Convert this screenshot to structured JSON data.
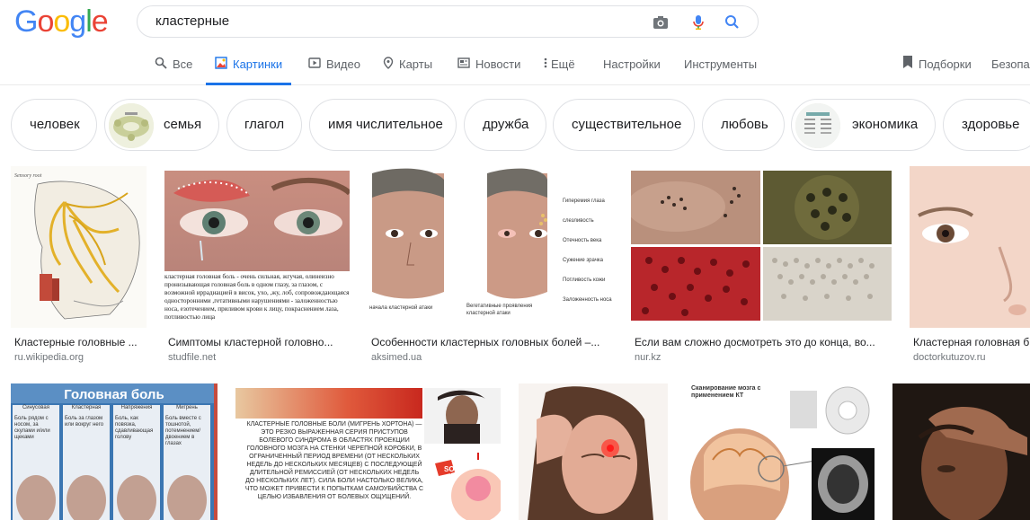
{
  "logo": [
    "G",
    "o",
    "o",
    "g",
    "l",
    "e"
  ],
  "search": {
    "query": "кластерные"
  },
  "icons": {
    "camera": "camera-icon",
    "mic": "mic-icon",
    "search": "search-icon"
  },
  "nav": {
    "all": "Все",
    "images": "Картинки",
    "video": "Видео",
    "maps": "Карты",
    "news": "Новости",
    "more": "Ещё",
    "settings": "Настройки",
    "tools": "Инструменты",
    "collections": "Подборки",
    "safe": "Безопа"
  },
  "chips": [
    "человек",
    "семья",
    "глагол",
    "имя числительное",
    "дружба",
    "существительное",
    "любовь",
    "экономика",
    "здоровье"
  ],
  "results": [
    {
      "caption": "Кластерные головные ...",
      "source": "ru.wikipedia.org"
    },
    {
      "caption": "Симптомы кластерной головно...",
      "source": "studfile.net"
    },
    {
      "caption": "Особенности кластерных головных болей –...",
      "source": "aksimed.ua"
    },
    {
      "caption": "Если вам сложно досмотреть это до конца, во...",
      "source": "nur.kz"
    },
    {
      "caption": "Кластерная головная б",
      "source": "doctorkutuzov.ru"
    }
  ],
  "image_text": {
    "r1_2_text": "кластерная головная боль - очень сильная, жгучая, олинеизно пронизывающая головная боль в одном глазу, за глазом, с возможной иррадиацией в висок, ухо, ,жу, лоб, сопровождающаяся односторонними ,гетативными нарушениями - заложенностью носа, езотечением, приливом крови к лицу, покраснением лаза, потливостью лица",
    "r1_3_labels": [
      "Гиперемия глаза слезливость",
      "Отечность века",
      "Сужение зрачка",
      "Потливость кожи",
      "Заложенность носа"
    ],
    "r1_3_left": "начала кластерной атаки",
    "r1_3_right": "Вегетативные проявления кластерной атаки",
    "r2_1_title": "Головная боль",
    "r2_1_cols": [
      "Синусовая",
      "Кластерная",
      "Напряжения",
      "Мигрень"
    ],
    "r2_1_desc": [
      "Боль рядом с носом, за скулами и/или щеками",
      "Боль за глазом или вокруг него",
      "Боль, как повязка, сдавливающая голову",
      "Боль вместе с тошнотой, потемнением/ двоением в глазах"
    ],
    "r2_2_text": "КЛАСТЕРНЫЕ ГОЛОВНЫЕ БОЛИ (МИГРЕНЬ ХОРТОНА) — ЭТО РЕЗКО ВЫРАЖЕННАЯ СЕРИЯ ПРИСТУПОВ БОЛЕВОГО СИНДРОМА В ОБЛАСТЯХ ПРОЕКЦИИ ГОЛОВНОГО МОЗГА НА СТЕНКИ ЧЕРЕПНОЙ КОРОБКИ, В ОГРАНИЧЕННЫЙ ПЕРИОД ВРЕМЕНИ (ОТ НЕСКОЛЬКИХ НЕДЕЛЬ ДО НЕСКОЛЬКИХ МЕСЯЦЕВ) С ПОСЛЕДУЮЩЕЙ ДЛИТЕЛЬНОЙ РЕМИССИЕЙ (ОТ НЕСКОЛЬКИХ НЕДЕЛЬ ДО НЕСКОЛЬКИХ ЛЕТ). СИЛА БОЛИ НАСТОЛЬКО ВЕЛИКА, ЧТО МОЖЕТ ПРИВЕСТИ К ПОПЫТКАМ САМОУБИЙСТВА С ЦЕЛЬЮ ИЗБАВЛЕНИЯ ОТ БОЛЕВЫХ ОЩУЩЕНИЙ.",
    "r2_2_sos": "SOS",
    "r2_4_text": "Сканирование мозга с применением КТ"
  },
  "colors": {
    "accent": "#1a73e8",
    "muted": "#5f6368",
    "border": "#dfe1e5"
  }
}
